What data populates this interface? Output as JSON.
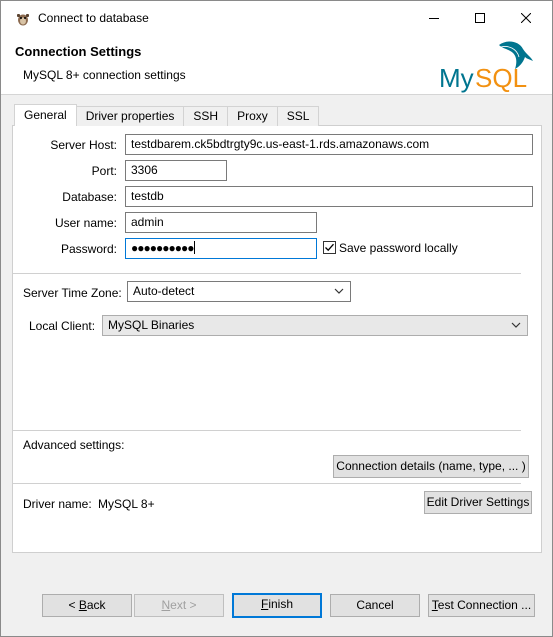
{
  "window": {
    "title": "Connect to database",
    "controls": [
      "minimize-icon",
      "maximize-icon",
      "close-icon"
    ]
  },
  "header": {
    "title": "Connection Settings",
    "subtitle": "MySQL 8+ connection settings",
    "logo_text": "MySQL",
    "logo_colors": {
      "my": "#00758f",
      "sql": "#f29111"
    }
  },
  "tabs": [
    {
      "label": "General",
      "active": true
    },
    {
      "label": "Driver properties",
      "active": false
    },
    {
      "label": "SSH",
      "active": false
    },
    {
      "label": "Proxy",
      "active": false
    },
    {
      "label": "SSL",
      "active": false
    }
  ],
  "form": {
    "server_host": {
      "label": "Server Host:",
      "value": "testdbarem.ck5bdtrgty9c.us-east-1.rds.amazonaws.com"
    },
    "port": {
      "label": "Port:",
      "value": "3306"
    },
    "database": {
      "label": "Database:",
      "value": "testdb"
    },
    "user_name": {
      "label": "User name:",
      "value": "admin"
    },
    "password": {
      "label": "Password:",
      "value": "●●●●●●●●●●"
    },
    "save_password": {
      "label": "Save password locally",
      "checked": true
    },
    "server_time_zone": {
      "label": "Server Time Zone:",
      "value": "Auto-detect"
    },
    "local_client": {
      "label": "Local Client:",
      "value": "MySQL Binaries"
    },
    "advanced_label": "Advanced settings:",
    "connection_details_button": "Connection details (name, type, ... )",
    "driver_name_label": "Driver name:",
    "driver_name_value": "MySQL 8+",
    "edit_driver_button": "Edit Driver Settings"
  },
  "footer": {
    "back": {
      "prefix": "< ",
      "mnemonic": "B",
      "rest": "ack"
    },
    "next": {
      "mnemonic": "N",
      "rest": "ext >"
    },
    "finish": {
      "mnemonic": "F",
      "rest": "inish"
    },
    "cancel": "Cancel",
    "test": {
      "mnemonic": "T",
      "rest": "est Connection ..."
    }
  },
  "colors": {
    "accent": "#0078d7",
    "title_bg": "#ffffff",
    "dialog_bg": "#f0f0f0"
  }
}
